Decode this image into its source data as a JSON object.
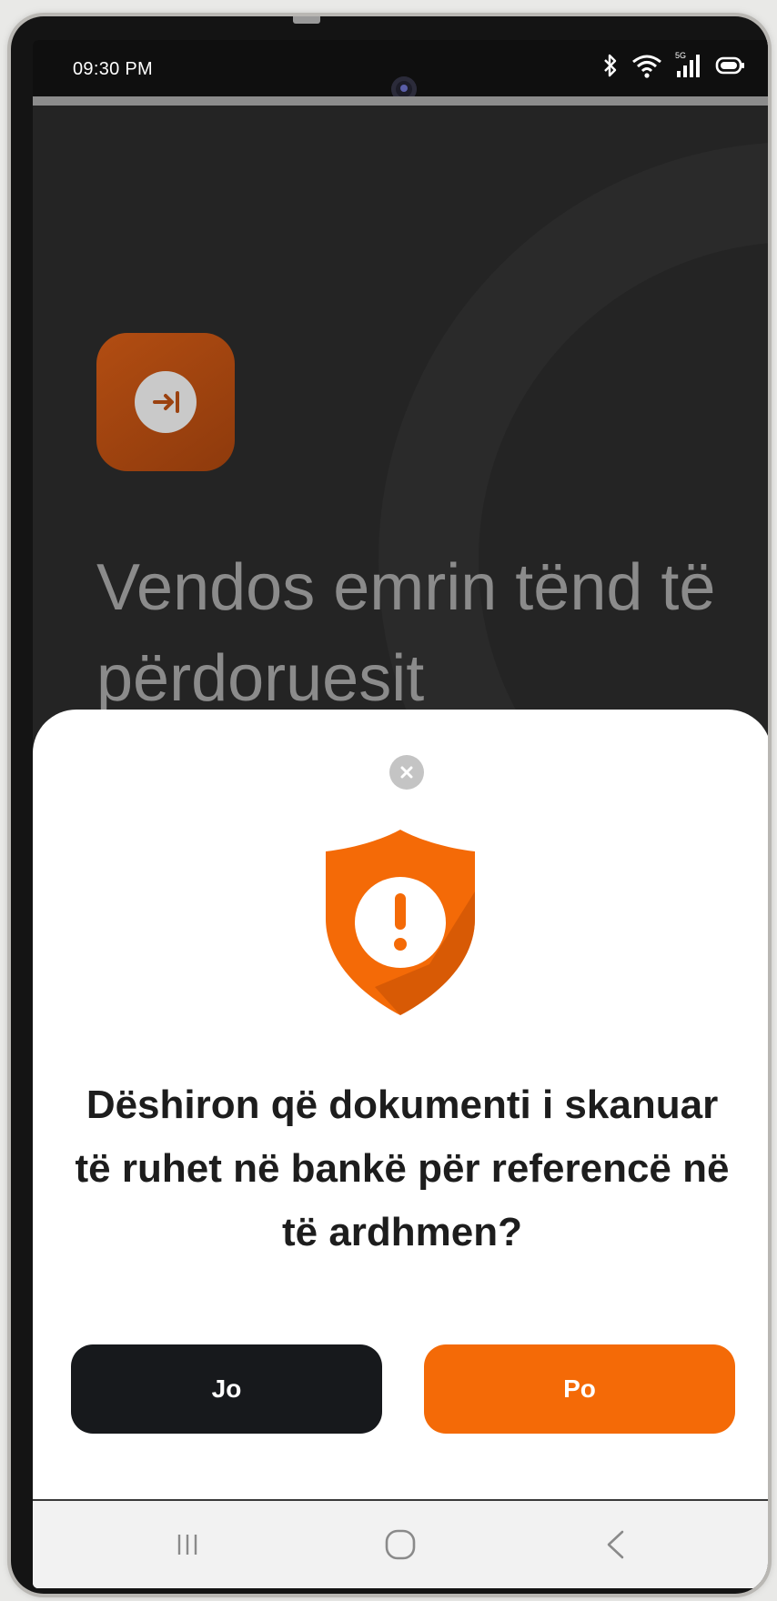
{
  "status_bar": {
    "time": "09:30 PM",
    "icons": [
      "bluetooth-icon",
      "wifi-icon",
      "signal-5g-icon",
      "battery-icon"
    ],
    "network_label": "5G"
  },
  "background": {
    "app_icon": "login-arrow-icon",
    "heading": "Vendos emrin tënd të përdoruesit"
  },
  "dialog": {
    "close_icon": "close-icon",
    "icon": "shield-alert-icon",
    "question": "Dëshiron që dokumenti i skanuar të ruhet në bankë për referencë në të ardhmen?",
    "no_label": "Jo",
    "yes_label": "Po"
  },
  "nav_bar": {
    "items": [
      "recent-apps-icon",
      "home-icon",
      "back-icon"
    ]
  },
  "colors": {
    "accent": "#f46a07",
    "dark_button": "#17191c",
    "background": "#242424"
  }
}
